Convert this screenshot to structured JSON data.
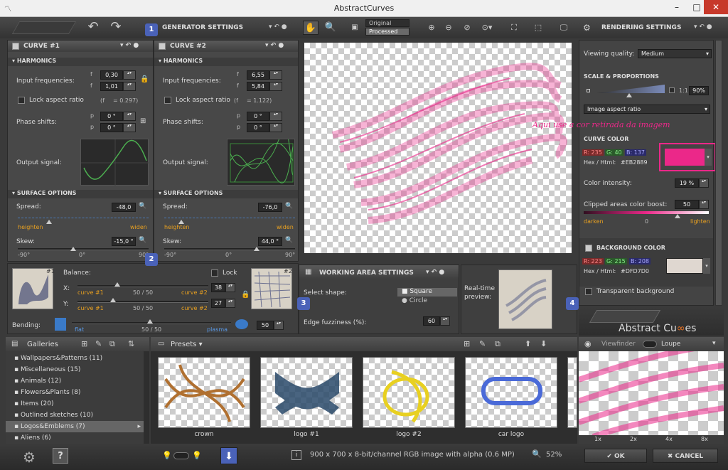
{
  "window": {
    "title": "AbstractCurves",
    "min": "–",
    "max": "□",
    "close": "✕"
  },
  "topbar": {
    "generator_settings": "GENERATOR SETTINGS",
    "rendering_settings": "RENDERING SETTINGS",
    "view_original": "Original",
    "view_processed": "Processed"
  },
  "curve1": {
    "title": "CURVE #1",
    "harmonics": "HARMONICS",
    "input_freq": "Input frequencies:",
    "fx_label": "f",
    "fy_label": "f",
    "fx": "0,30",
    "fy": "1,01",
    "lock_aspect": "Lock aspect ratio",
    "lock_ratio_text": "(f",
    "lock_ratio_val": "= 0.297)",
    "phase_shifts": "Phase shifts:",
    "px_label": "p",
    "py_label": "p",
    "px": "0 °",
    "py": "0 °",
    "output_signal": "Output signal:",
    "surface_options": "SURFACE OPTIONS",
    "spread": "Spread:",
    "spread_val": "-48,0",
    "heighten": "heighten",
    "widen": "widen",
    "skew": "Skew:",
    "skew_val": "-15,0 °",
    "skew_min": "-90°",
    "skew_mid": "0°",
    "skew_max": "90°"
  },
  "curve2": {
    "title": "CURVE #2",
    "harmonics": "HARMONICS",
    "input_freq": "Input frequencies:",
    "fx_label": "f",
    "fy_label": "f",
    "fx": "6,55",
    "fy": "5,84",
    "lock_aspect": "Lock aspect ratio",
    "lock_ratio_text": "(f",
    "lock_ratio_val": "= 1.122)",
    "phase_shifts": "Phase shifts:",
    "px_label": "p",
    "py_label": "p",
    "px": "0 °",
    "py": "0 °",
    "output_signal": "Output signal:",
    "surface_options": "SURFACE OPTIONS",
    "spread": "Spread:",
    "spread_val": "-76,0",
    "heighten": "heighten",
    "widen": "widen",
    "skew": "Skew:",
    "skew_val": "44,0 °",
    "skew_min": "-90°",
    "skew_mid": "0°",
    "skew_max": "90°"
  },
  "balance": {
    "label": "Balance:",
    "lock": "Lock",
    "x_label": "X:",
    "y_label": "Y:",
    "curve1": "curve #1",
    "curve2": "curve #2",
    "x_mid": "50 / 50",
    "y_mid": "50 / 50",
    "x_val": "38",
    "y_val": "27",
    "thumb1_badge": "#1",
    "thumb2_badge": "#2"
  },
  "bending": {
    "label": "Bending:",
    "flat": "flat",
    "plasma": "plasma",
    "mid": "50 / 50",
    "val": "50"
  },
  "working_area": {
    "title": "WORKING AREA SETTINGS",
    "select_shape": "Select shape:",
    "square": "Square",
    "circle": "Circle",
    "realtime": "Real-time",
    "preview": "preview:",
    "edge_fuzz": "Edge fuzziness (%):",
    "edge_val": "60"
  },
  "rendering": {
    "viewing_quality": "Viewing quality:",
    "quality_val": "Medium",
    "scale_title": "SCALE & PROPORTIONS",
    "scale_ratio": "1:1",
    "scale_pct": "90%",
    "aspect_select": "Image aspect ratio",
    "annotation": "Aqui use a cor retirada da imagem",
    "curve_color_title": "CURVE COLOR",
    "r": "R: 235",
    "g": "G: 40",
    "b": "B: 137",
    "hex_label": "Hex / Html:",
    "hex_val": "#EB2889",
    "curve_color": "#EB2889",
    "intensity_label": "Color intensity:",
    "intensity_val": "19 %",
    "boost_label": "Clipped areas color boost:",
    "boost_val": "50",
    "darken": "darken",
    "boost_mid": "0",
    "lighten": "lighten",
    "bg_title": "BACKGROUND COLOR",
    "bg_r": "R: 223",
    "bg_g": "G: 215",
    "bg_b": "B: 208",
    "bg_hex_label": "Hex / Html:",
    "bg_hex_val": "#DFD7D0",
    "bg_color": "#DFD7D0",
    "transparent_bg": "Transparent background",
    "logo": "Abstract Cu",
    "logo2": "es"
  },
  "markers": {
    "m1": "1",
    "m2": "2",
    "m3": "3",
    "m4": "4"
  },
  "galleries": {
    "title": "Galleries",
    "items": [
      "Wallpapers&Patterns (11)",
      "Miscellaneous (15)",
      "Animals (12)",
      "Flowers&Plants (8)",
      "Items (20)",
      "Outlined sketches (10)",
      "Logos&Emblems (7)",
      "Aliens (6)"
    ],
    "selected_index": 6
  },
  "presets": {
    "title": "Presets",
    "items": [
      "crown",
      "logo #1",
      "logo #2",
      "car logo"
    ]
  },
  "viewfinder": {
    "viewfinder": "Viewfinder",
    "loupe": "Loupe",
    "zooms": [
      "1x",
      "2x",
      "4x",
      "8x"
    ]
  },
  "status": {
    "info": "900 x 700 x 8-bit/channel RGB image with alpha  (0.6 MP)",
    "zoom": "52%",
    "ok": "OK",
    "cancel": "CANCEL"
  }
}
